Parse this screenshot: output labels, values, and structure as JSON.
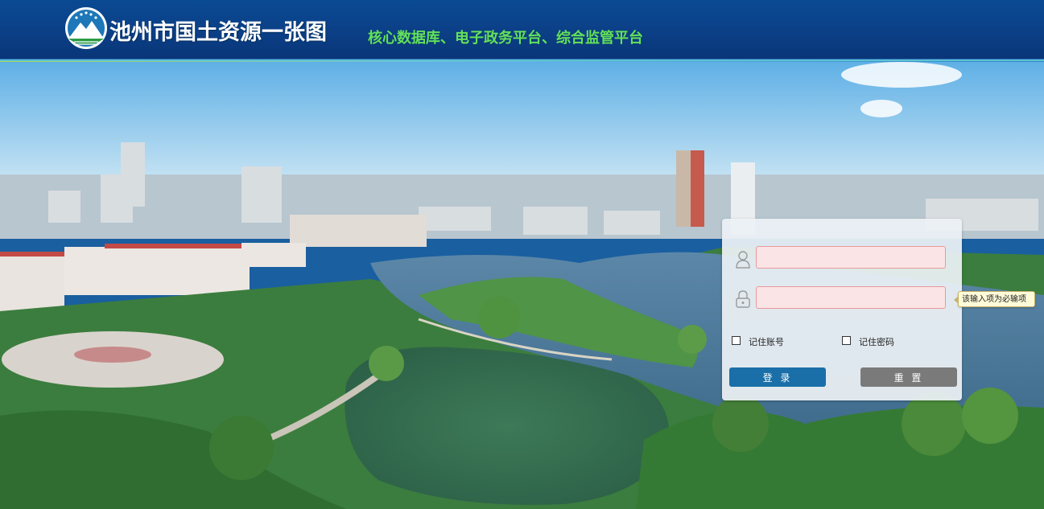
{
  "header": {
    "title": "池州市国土资源一张图",
    "subtitle": "核心数据库、电子政务平台、综合监管平台"
  },
  "login": {
    "username_value": "",
    "password_value": "",
    "tooltip": "该输入项为必输项",
    "remember_account": "记住账号",
    "remember_password": "记住密码",
    "login_button": "登 录",
    "reset_button": "重 置"
  },
  "colors": {
    "header_bg": "#0b3f86",
    "subtitle": "#63e05c",
    "login_button": "#1a6fa8",
    "reset_button": "#7a7a7a",
    "invalid_field": "#fbe4e6"
  },
  "icons": [
    "logo-icon",
    "user-icon",
    "lock-icon"
  ]
}
